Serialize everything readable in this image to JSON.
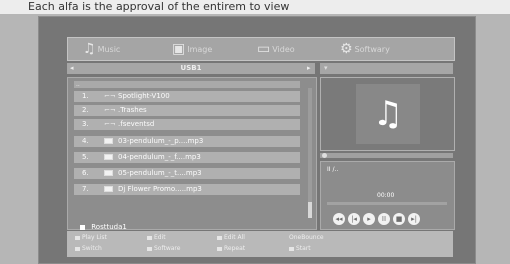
{
  "top_text": "Each alfa is the approval of the entirem to view",
  "tabs": [
    {
      "label": "Music",
      "icon": "music-note-icon"
    },
    {
      "label": "Image",
      "icon": "image-icon"
    },
    {
      "label": "Video",
      "icon": "video-icon"
    },
    {
      "label": "Softwary",
      "icon": "software-icon"
    }
  ],
  "browser": {
    "path_title": "USB1",
    "list_header": "..",
    "rows": [
      {
        "num": "1.",
        "type": "folder",
        "name": "Spotlight-V100"
      },
      {
        "num": "2.",
        "type": "folder",
        "name": ".Trashes"
      },
      {
        "num": "3.",
        "type": "folder",
        "name": ".fseventsd"
      },
      {
        "num": "4.",
        "type": "music",
        "name": "03-pendulum_-_p....mp3"
      },
      {
        "num": "5.",
        "type": "music",
        "name": "04-pendulum_-_f....mp3"
      },
      {
        "num": "6.",
        "type": "music",
        "name": "05-pendulum_-_t....mp3"
      },
      {
        "num": "7.",
        "type": "music",
        "name": "Dj Flower Promo.....mp3"
      }
    ],
    "selected_status": "Rosttuda1"
  },
  "player": {
    "state": "II /..",
    "time": "00:00",
    "progress": 0.0,
    "controls": [
      "rewind-icon",
      "prev-icon",
      "play-icon",
      "pause-icon",
      "stop-icon",
      "next-icon"
    ]
  },
  "bottom_hints": {
    "row1": [
      "Play List",
      "Edit",
      "Edit All",
      "OneBounce"
    ],
    "row2": [
      "Switch",
      "Software",
      "Repeat",
      "Start"
    ]
  },
  "colors": {
    "background": "#b6b6b6",
    "screen": "#767676",
    "panel": "#8d8d8d"
  }
}
